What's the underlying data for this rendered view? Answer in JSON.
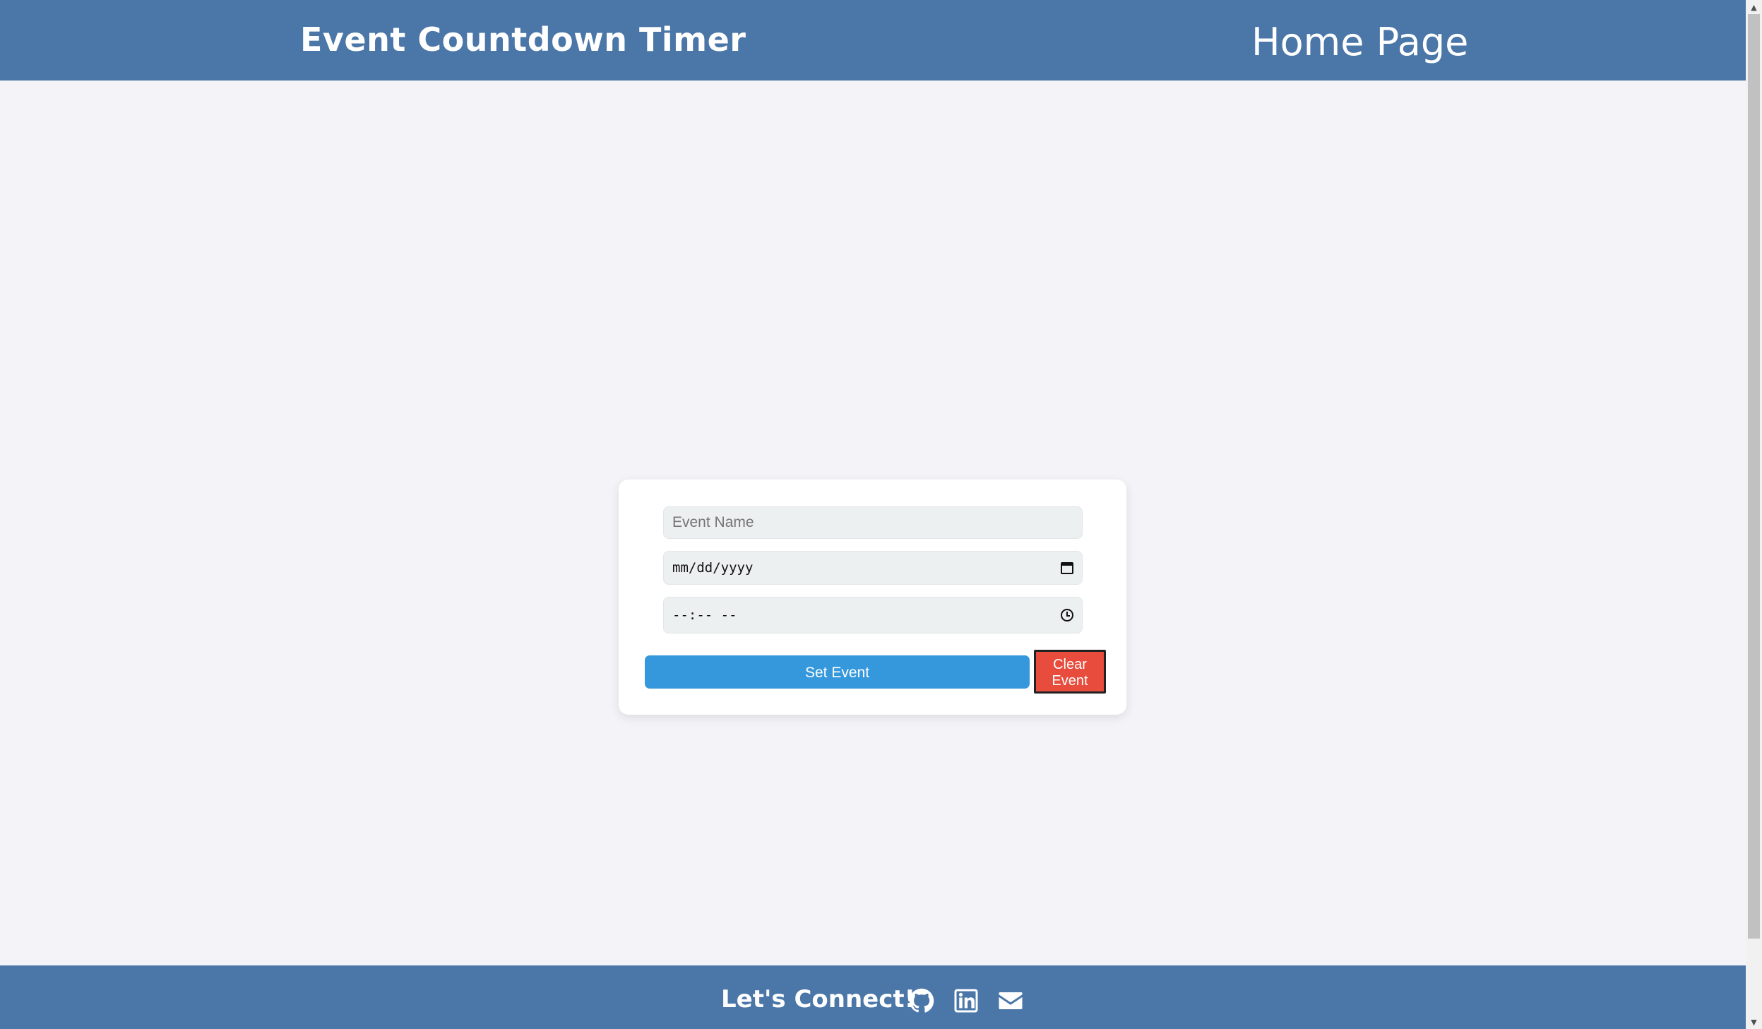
{
  "header": {
    "title": "Event Countdown Timer",
    "nav_link": "Home Page"
  },
  "form": {
    "event_name_placeholder": "Event Name",
    "date_placeholder": "mm/dd/yyyy",
    "time_placeholder": "--:-- --",
    "set_button": "Set Event",
    "clear_button": "Clear Event"
  },
  "footer": {
    "connect_text": "Let's Connect!",
    "icons": [
      "github-icon",
      "linkedin-icon",
      "mail-icon"
    ]
  },
  "colors": {
    "header_bg": "#4a76a8",
    "page_bg": "#f4f4f8",
    "set_button": "#3598dc",
    "clear_button": "#e74c3c"
  }
}
